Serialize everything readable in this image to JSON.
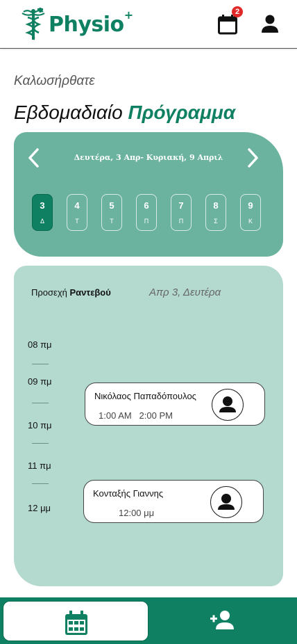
{
  "header": {
    "logo_text": "Physio",
    "logo_sup": "+",
    "notification_count": "2",
    "calendar_icon": "calendar-icon",
    "profile_icon": "user-icon"
  },
  "greeting": "Καλωσήρθατε",
  "title": {
    "part1": "Εβδομαδιαίο ",
    "accent": "Πρόγραμμα"
  },
  "week": {
    "range": "Δευτέρα, 3 Απρ- Κυριακή, 9 Απριλ",
    "days": [
      {
        "num": "3",
        "letter": "Δ",
        "active": true
      },
      {
        "num": "4",
        "letter": "Τ"
      },
      {
        "num": "5",
        "letter": "Τ"
      },
      {
        "num": "6",
        "letter": "Π"
      },
      {
        "num": "7",
        "letter": "Π"
      },
      {
        "num": "8",
        "letter": "Σ"
      },
      {
        "num": "9",
        "letter": "Κ"
      }
    ]
  },
  "appointments": {
    "heading_prefix": "Προσεχή ",
    "heading_bold": "Ραντεβού",
    "date": "Απρ 3, Δευτέρα",
    "times": [
      "08 πμ",
      "09 πμ",
      "10 πμ",
      "11 πμ",
      "12 μμ"
    ],
    "items": [
      {
        "name": "Νικόλαος Παπαδόπουλος",
        "time": "1:00 AM   2:00 PM"
      },
      {
        "name": "Κονταξής Γιαννης",
        "time": "12:00 μμ"
      }
    ]
  },
  "colors": {
    "brand": "#0f8062",
    "card": "#6bb39e",
    "panel": "#b4d9cf",
    "badge": "#e32828"
  }
}
